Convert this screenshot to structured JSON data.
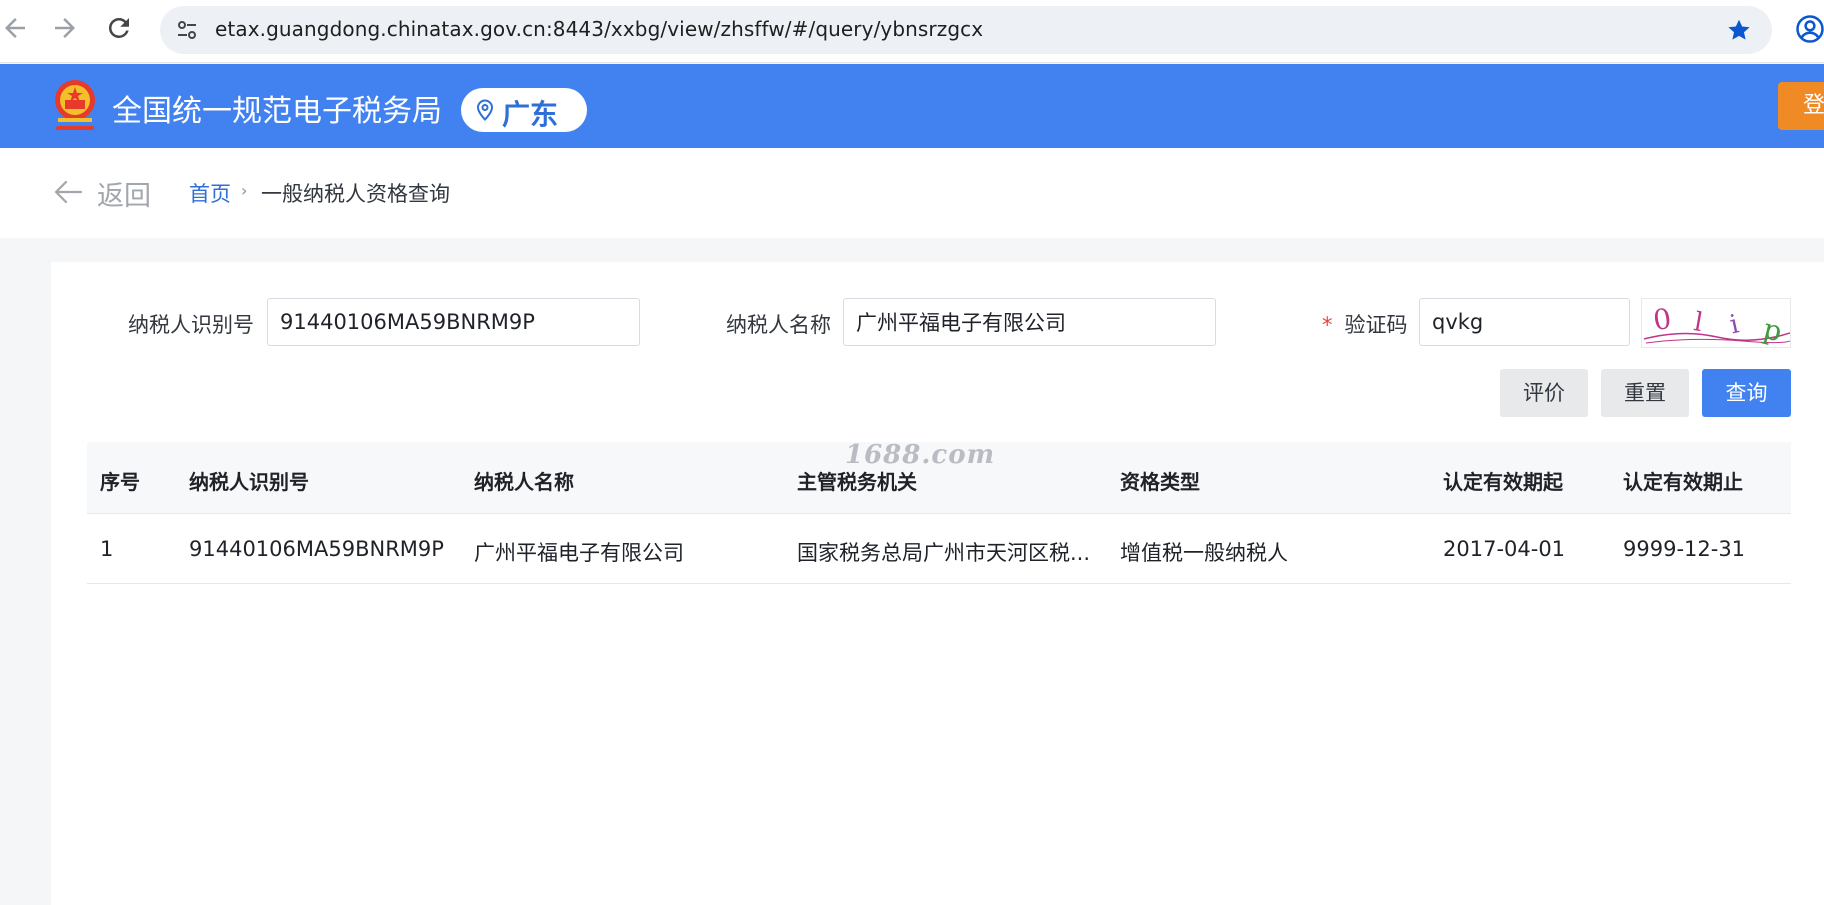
{
  "browser": {
    "url": "etax.guangdong.chinatax.gov.cn:8443/xxbg/view/zhsffw/#/query/ybnsrzgcx",
    "icons": [
      "back-arrow-icon",
      "forward-arrow-icon",
      "reload-icon",
      "site-settings-icon",
      "bookmark-star-icon",
      "profile-icon"
    ]
  },
  "header": {
    "site_title": "全国统一规范电子税务局",
    "region": "广东",
    "login_label": "登录"
  },
  "breadcrumb": {
    "back_label": "返回",
    "home": "首页",
    "separator": "›",
    "current": "一般纳税人资格查询"
  },
  "form": {
    "taxpayer_id_label": "纳税人识别号",
    "taxpayer_id_value": "91440106MA59BNRM9P",
    "taxpayer_name_label": "纳税人名称",
    "taxpayer_name_value": "广州平福电子有限公司",
    "captcha_required_mark": "*",
    "captcha_label": "验证码",
    "captcha_value": "qvkg",
    "captcha_image_text": "0lip"
  },
  "buttons": {
    "evaluate": "评价",
    "reset": "重置",
    "query": "查询"
  },
  "table": {
    "columns": [
      "序号",
      "纳税人识别号",
      "纳税人名称",
      "主管税务机关",
      "资格类型",
      "认定有效期起",
      "认定有效期止"
    ],
    "rows": [
      [
        "1",
        "91440106MA59BNRM9P",
        "广州平福电子有限公司",
        "国家税务总局广州市天河区税...",
        "增值税一般纳税人",
        "2017-04-01",
        "9999-12-31"
      ]
    ]
  },
  "watermark": "1688.com",
  "colors": {
    "header_blue": "#4182f0",
    "login_orange": "#f08a24",
    "link_blue": "#2f6fd7",
    "required_red": "#e64340"
  }
}
